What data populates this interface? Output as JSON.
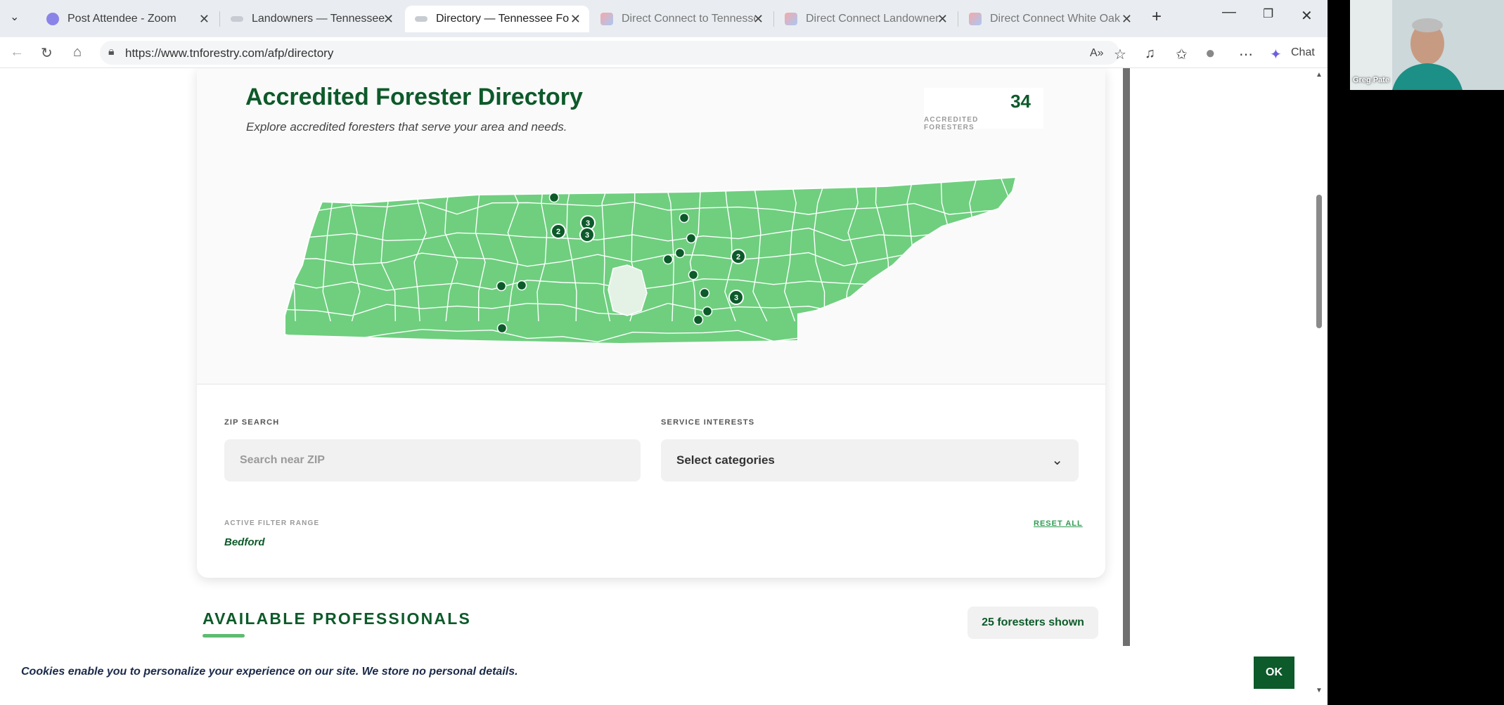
{
  "browser": {
    "tabs": [
      {
        "title": "Post Attendee - Zoom",
        "active": false
      },
      {
        "title": "Landowners — Tennessee For",
        "active": false
      },
      {
        "title": "Directory — Tennessee Forest",
        "active": true
      },
      {
        "title": "Direct Connect to Tennessee",
        "active": false
      },
      {
        "title": "Direct Connect Landowner Si",
        "active": false
      },
      {
        "title": "Direct Connect White Oak Si",
        "active": false
      }
    ],
    "url": "https://www.tnforestry.com/afp/directory",
    "chat_label": "Chat"
  },
  "directory": {
    "title": "Accredited Forester Directory",
    "subtitle": "Explore accredited foresters that serve your area and needs.",
    "count": "34",
    "count_label": "ACCREDITED FORESTERS",
    "map_pins": [
      {
        "label": ""
      },
      {
        "label": "2"
      },
      {
        "label": "3"
      },
      {
        "label": "3"
      },
      {
        "label": ""
      },
      {
        "label": ""
      },
      {
        "label": ""
      },
      {
        "label": ""
      },
      {
        "label": "2"
      },
      {
        "label": ""
      },
      {
        "label": ""
      },
      {
        "label": ""
      },
      {
        "label": "3"
      },
      {
        "label": ""
      },
      {
        "label": ""
      },
      {
        "label": ""
      },
      {
        "label": ""
      }
    ]
  },
  "filters": {
    "zip_label": "ZIP SEARCH",
    "zip_placeholder": "Search near ZIP",
    "service_label": "SERVICE INTERESTS",
    "service_value": "Select categories",
    "active_range_label": "ACTIVE FILTER RANGE",
    "active_range_value": "Bedford",
    "reset_label": "RESET ALL"
  },
  "results": {
    "heading": "AVAILABLE PROFESSIONALS",
    "shown": "25 foresters shown"
  },
  "cookie": {
    "text": "Cookies enable you to personalize your experience on our site. We store no personal details.",
    "ok": "OK"
  },
  "webcam": {
    "name": "Greg Pate"
  },
  "colors": {
    "brand_green": "#0d5a2a",
    "map_fill": "#6fcf7f",
    "selected_county": "#e4f2e6"
  }
}
